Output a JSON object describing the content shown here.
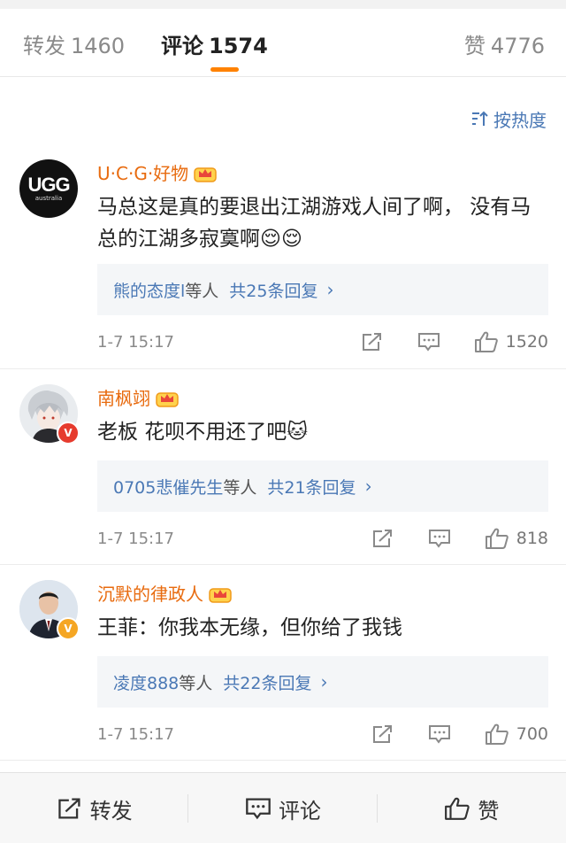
{
  "tabs": {
    "reposts": {
      "label": "转发",
      "count": "1460"
    },
    "comments": {
      "label": "评论",
      "count": "1574"
    },
    "likes": {
      "label": "赞",
      "count": "4776"
    }
  },
  "sort": {
    "label": "按热度",
    "icon": "sort-icon"
  },
  "colors": {
    "accent": "#ff8200",
    "link": "#4a78b5",
    "username": "#e86b0f",
    "verified_orange": "#f5a623",
    "verified_red": "#e63b2e"
  },
  "comments": [
    {
      "username": "U·C·G·好物",
      "avatar_text": "UGG",
      "avatar_subtext": "australia",
      "text": "马总这是真的要退出江湖游戏人间了啊， 没有马总的江湖多寂寞啊😌😌",
      "reply_users": "熊的态度l",
      "reply_mid": "等人",
      "reply_count": "共25条回复",
      "time": "1-7 15:17",
      "likes": "1520"
    },
    {
      "username": "南枫翊",
      "avatar_text": "",
      "text": "老板 花呗不用还了吧🐱",
      "reply_users": "0705悲催先生",
      "reply_mid": "等人",
      "reply_count": "共21条回复",
      "time": "1-7 15:17",
      "likes": "818"
    },
    {
      "username": "沉默的律政人",
      "avatar_text": "",
      "text": "王菲：你我本无缘，但你给了我钱",
      "reply_users": "凌度888",
      "reply_mid": "等人",
      "reply_count": "共22条回复",
      "time": "1-7 15:17",
      "likes": "700"
    }
  ],
  "bottom_bar": {
    "repost": "转发",
    "comment": "评论",
    "like": "赞"
  }
}
